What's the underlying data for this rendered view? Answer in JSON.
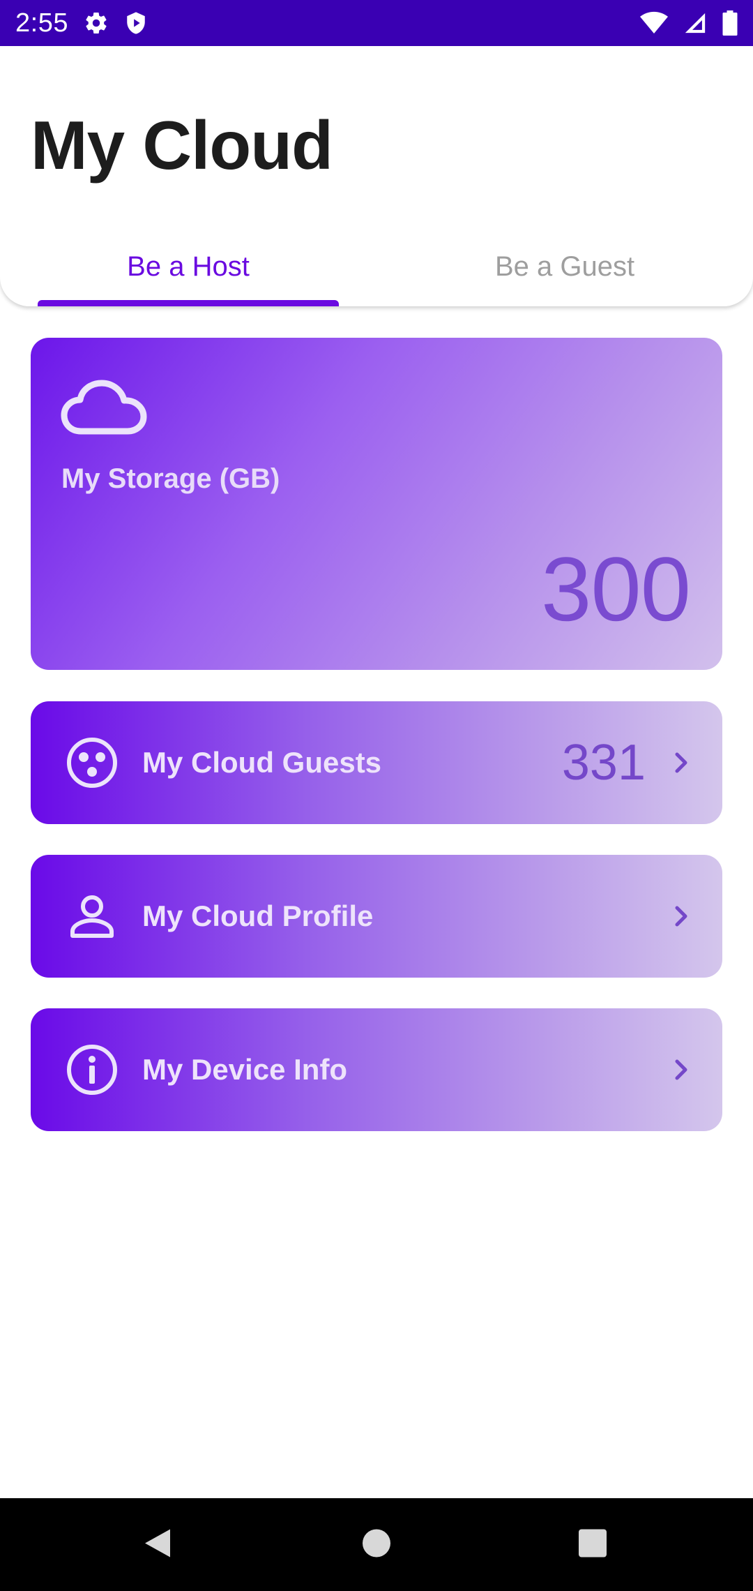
{
  "status_bar": {
    "time": "2:55",
    "left_icons": [
      "gear-icon",
      "shield-icon"
    ],
    "right_icons": [
      "wifi-icon",
      "signal-icon",
      "battery-icon"
    ],
    "background": "#3a00b3"
  },
  "header": {
    "title": "My Cloud",
    "tabs": [
      {
        "label": "Be a Host",
        "active": true
      },
      {
        "label": "Be a Guest",
        "active": false
      }
    ],
    "accent": "#6a0ae0"
  },
  "storage_card": {
    "icon": "cloud-icon",
    "label": "My Storage (GB)",
    "value": "300"
  },
  "menu": [
    {
      "icon": "guests-icon",
      "label": "My Cloud Guests",
      "count": "331",
      "chevron": "chevron-right-icon"
    },
    {
      "icon": "person-icon",
      "label": "My Cloud Profile",
      "chevron": "chevron-right-icon"
    },
    {
      "icon": "info-icon",
      "label": "My Device Info",
      "chevron": "chevron-right-icon"
    }
  ],
  "nav_bar": {
    "buttons": [
      "back-icon",
      "home-icon",
      "recents-icon"
    ]
  }
}
